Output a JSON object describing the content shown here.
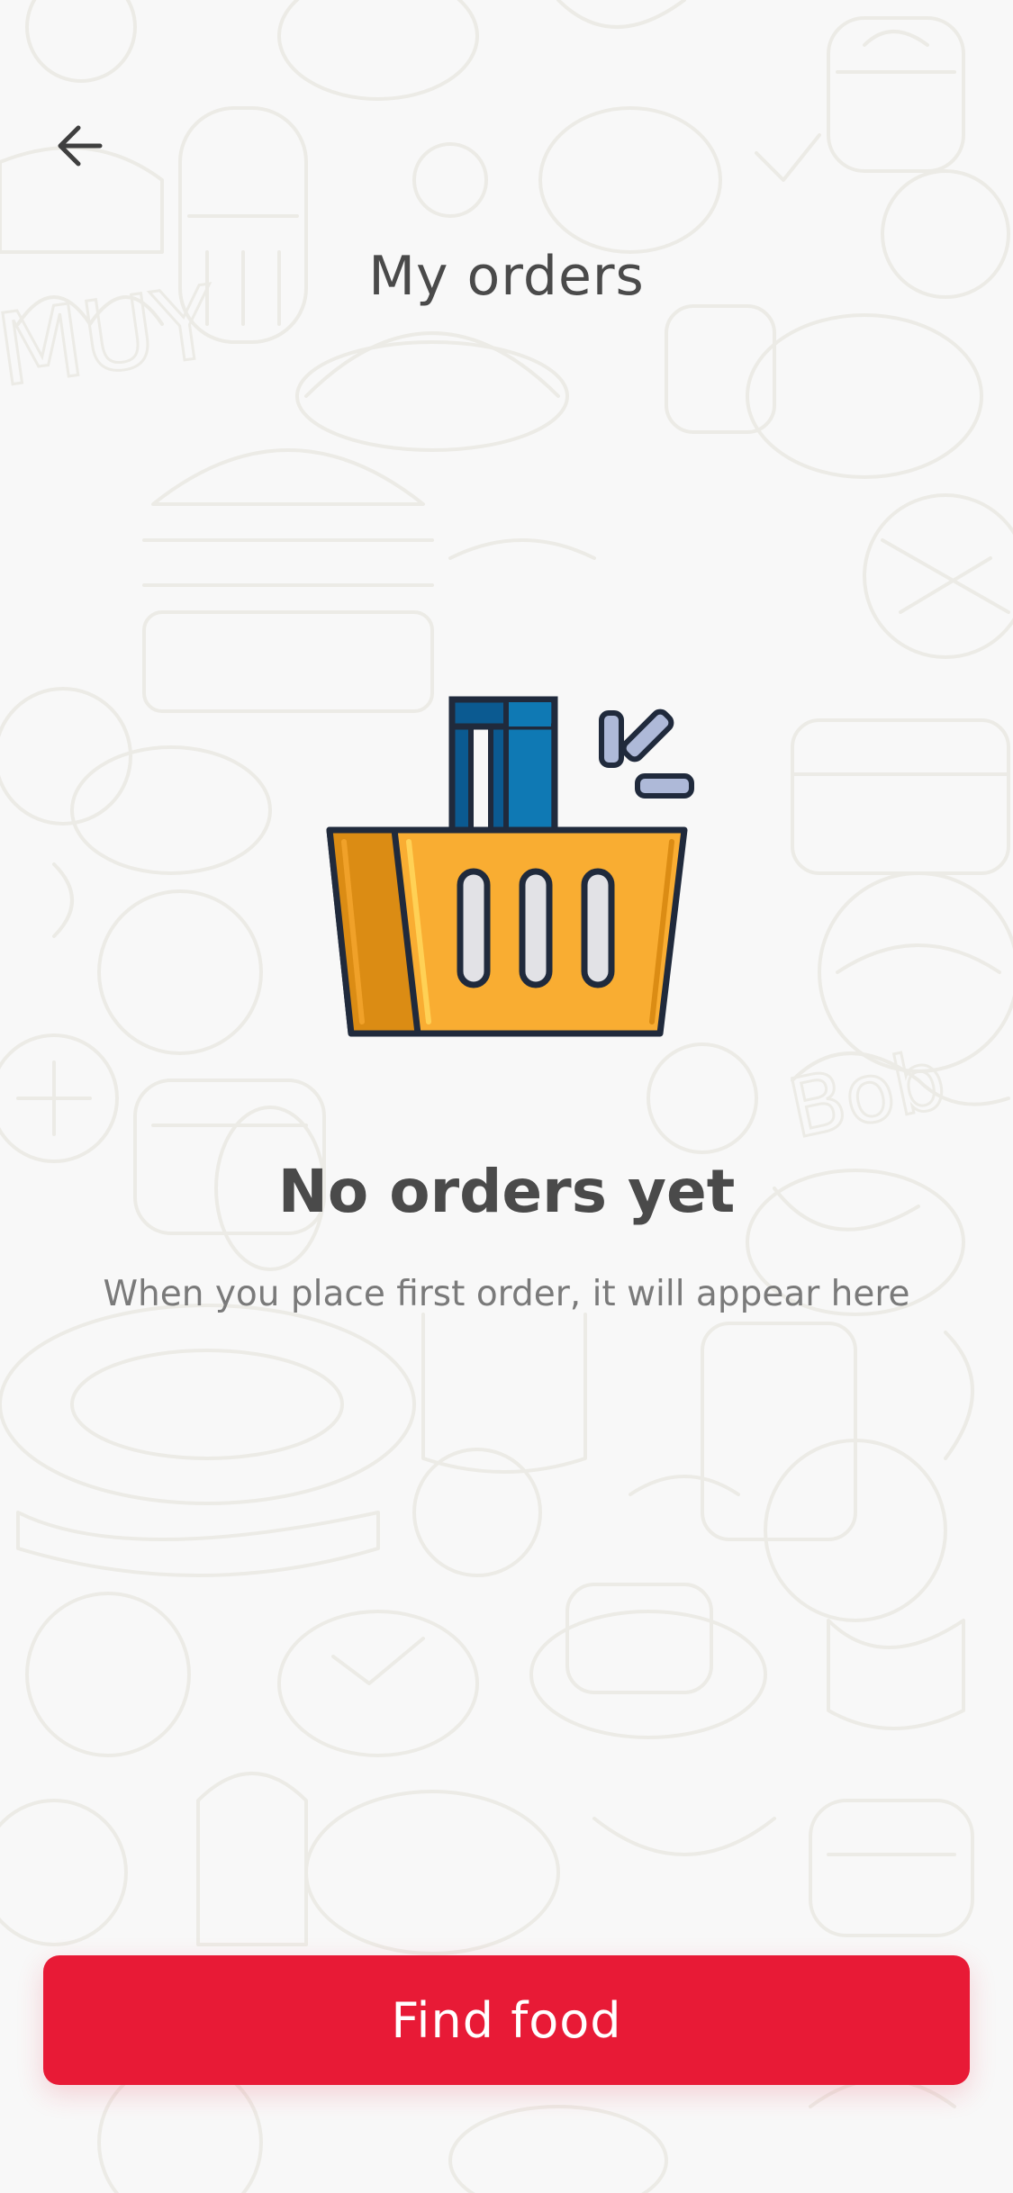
{
  "header": {
    "title": "My orders",
    "back_icon": "arrow-left-icon"
  },
  "empty_state": {
    "illustration": "shopping-basket-icon",
    "title": "No orders yet",
    "subtitle": "When you place first order, it will appear here"
  },
  "cta": {
    "label": "Find food"
  },
  "colors": {
    "background": "#f8f8f8",
    "primary": "#e81a36",
    "title_text": "#4a4a4a",
    "subtitle_text": "#7a7a7a",
    "basket_orange": "#f9ad32",
    "basket_dark_orange": "#db8c14",
    "handle_blue": "#0f79b4",
    "handle_dark_blue": "#0b5a91"
  }
}
